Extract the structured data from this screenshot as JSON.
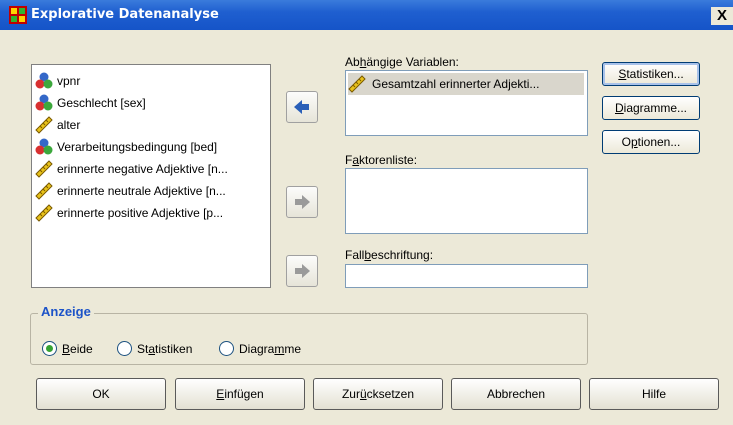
{
  "window": {
    "title": "Explorative Datenanalyse",
    "close_glyph": "X"
  },
  "source_variables": [
    {
      "label": "vpnr",
      "icon": "nominal-icon"
    },
    {
      "label": "Geschlecht [sex]",
      "icon": "nominal-icon"
    },
    {
      "label": "alter",
      "icon": "scale-icon"
    },
    {
      "label": "Verarbeitungsbedingung [bed]",
      "icon": "nominal-icon"
    },
    {
      "label": "erinnerte negative Adjektive [n...",
      "icon": "scale-icon"
    },
    {
      "label": "erinnerte neutrale Adjektive [n...",
      "icon": "scale-icon"
    },
    {
      "label": "erinnerte positive Adjektive [p...",
      "icon": "scale-icon"
    }
  ],
  "dependent": {
    "label_pre": "Ab",
    "label_u": "h",
    "label_post": "ängige Variablen:",
    "items": [
      {
        "label": "Gesamtzahl erinnerter Adjekti...",
        "icon": "scale-icon"
      }
    ]
  },
  "factor": {
    "label_pre": "F",
    "label_u": "a",
    "label_post": "ktorenliste:"
  },
  "case_label": {
    "label_pre": "Fall",
    "label_u": "b",
    "label_post": "eschriftung:",
    "value": ""
  },
  "side_buttons": [
    {
      "pre": "",
      "u": "S",
      "post": "tatistiken..."
    },
    {
      "pre": "",
      "u": "D",
      "post": "iagramme..."
    },
    {
      "pre": "O",
      "u": "p",
      "post": "tionen..."
    }
  ],
  "display": {
    "title": "Anzeige",
    "options": [
      {
        "pre": "",
        "u": "B",
        "post": "eide",
        "selected": true
      },
      {
        "pre": "St",
        "u": "a",
        "post": "tistiken",
        "selected": false
      },
      {
        "pre": "Diagra",
        "u": "m",
        "post": "me",
        "selected": false
      }
    ]
  },
  "bottom_buttons": [
    {
      "pre": "OK",
      "u": "",
      "post": ""
    },
    {
      "pre": "",
      "u": "E",
      "post": "infügen"
    },
    {
      "pre": "Zur",
      "u": "ü",
      "post": "cksetzen"
    },
    {
      "pre": "Abbrechen",
      "u": "",
      "post": ""
    },
    {
      "pre": "Hilfe",
      "u": "",
      "post": ""
    }
  ],
  "colors": {
    "titlebar": "#1f5fd0",
    "group_title": "#1c53c8",
    "radio_dot": "#35a233"
  }
}
